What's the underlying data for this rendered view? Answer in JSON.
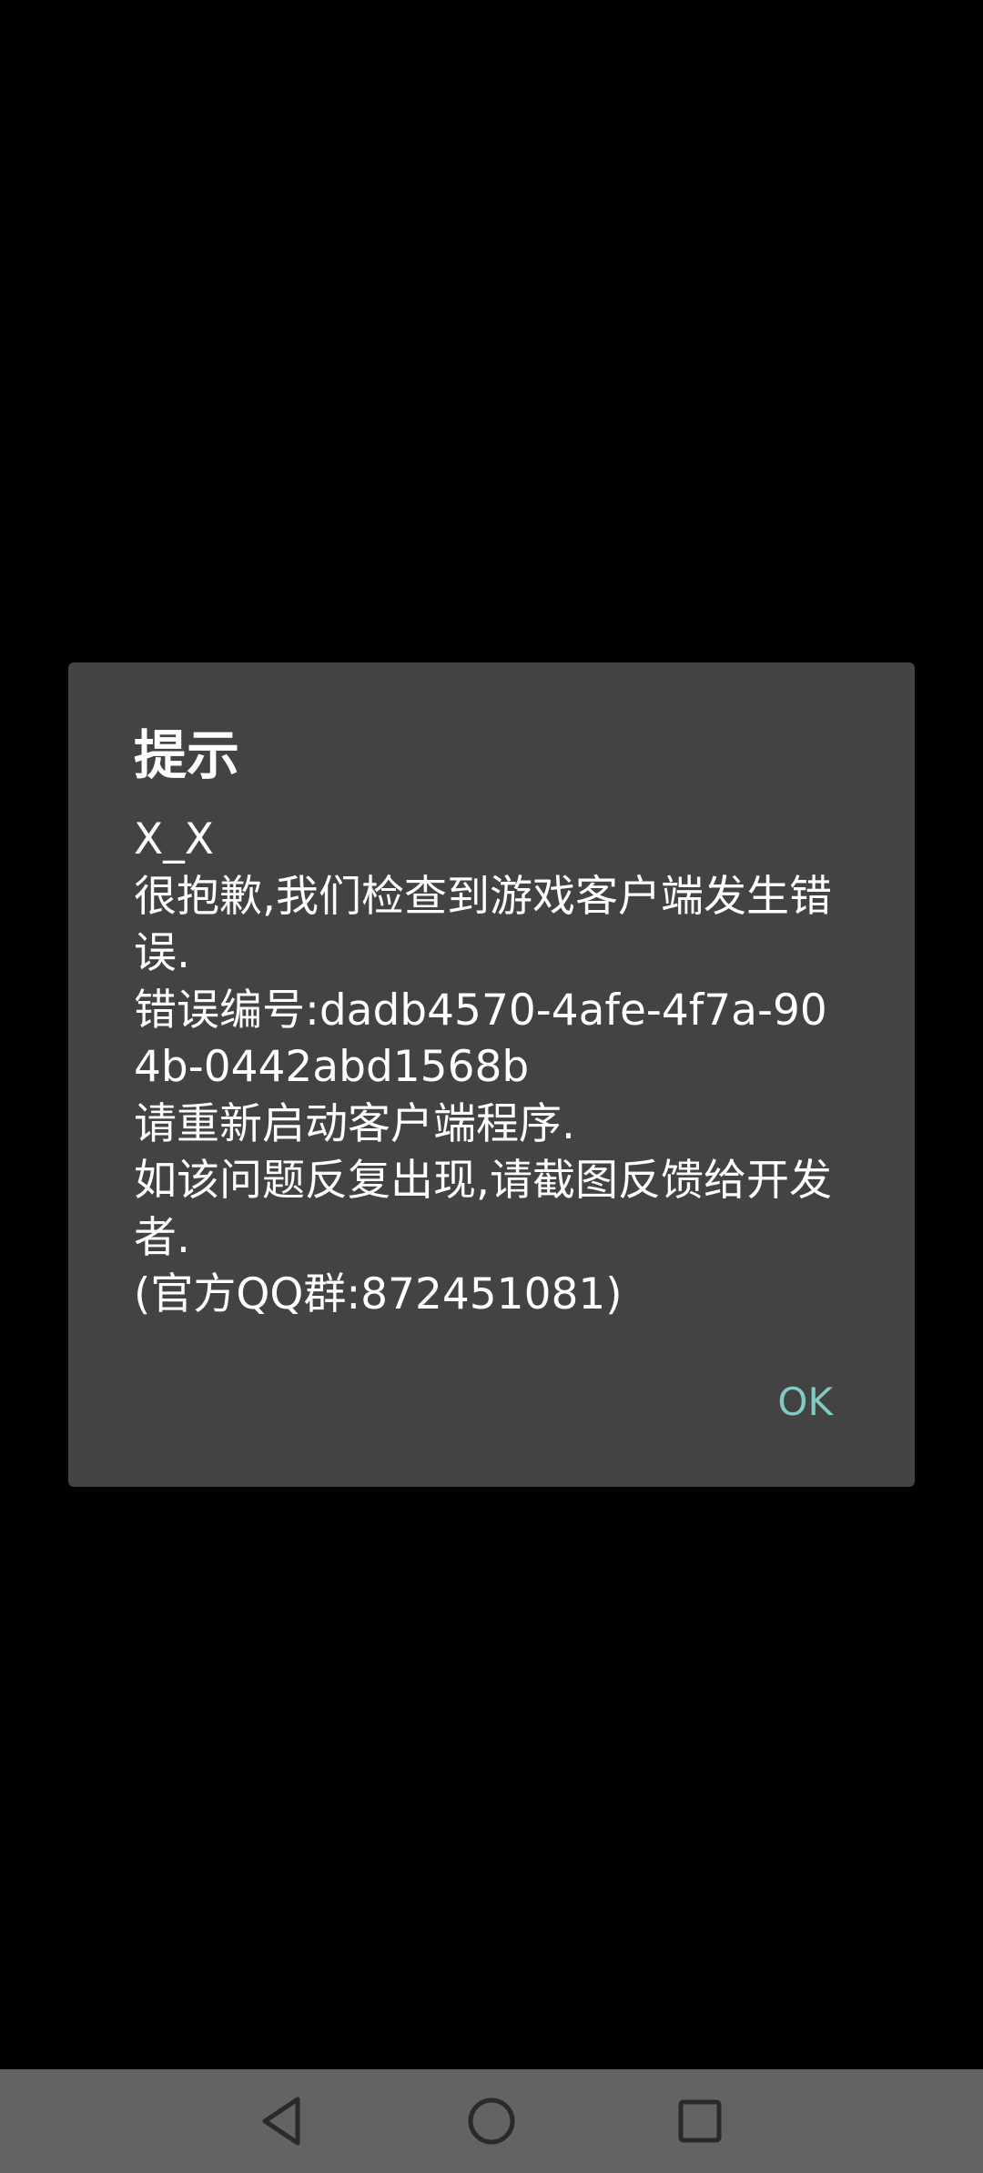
{
  "dialog": {
    "title": "提示",
    "message": "X_X\n很抱歉,我们检查到游戏客户端发生错误.\n错误编号:dadb4570-4afe-4f7a-904b-0442abd1568b\n请重新启动客户端程序.\n如该问题反复出现,请截图反馈给开发者.\n(官方QQ群:872451081)",
    "ok_label": "OK"
  },
  "colors": {
    "background": "#000000",
    "dialog_background": "#434343",
    "text": "#ffffff",
    "accent": "#80cbc4",
    "nav_bar": "#636363"
  },
  "nav": {
    "icons": [
      "back-icon",
      "home-icon",
      "recent-apps-icon"
    ]
  }
}
